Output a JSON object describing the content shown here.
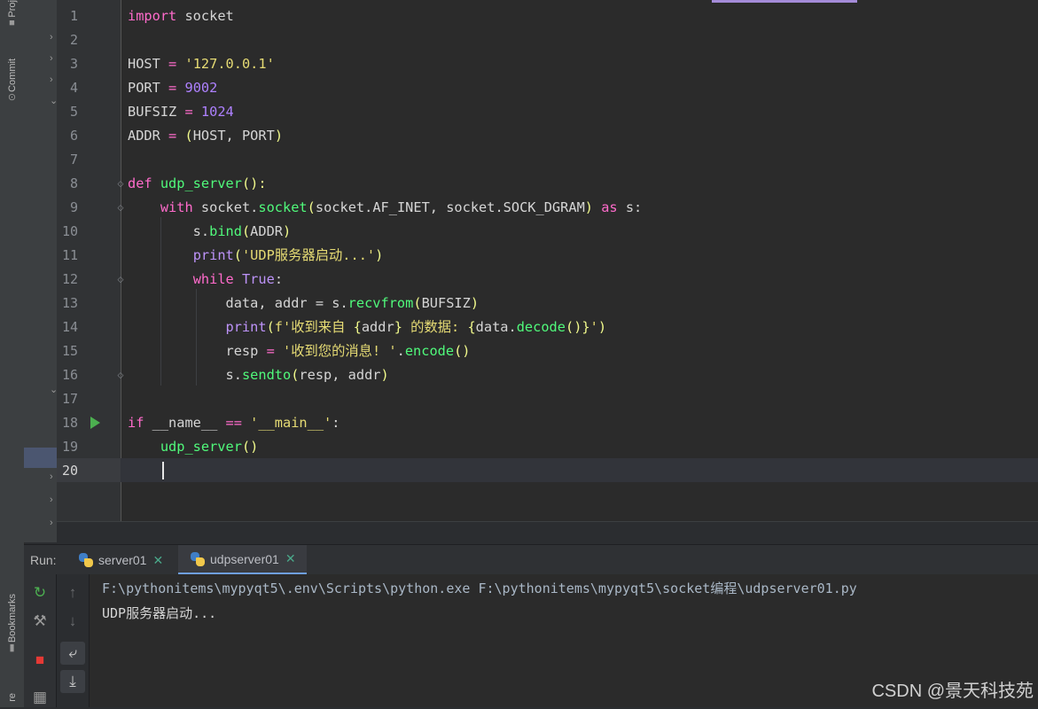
{
  "tool_window_stripe": {
    "project_label": "Proj",
    "commit_label": "Commit",
    "bookmarks_label": "Bookmarks",
    "structure_label": "re"
  },
  "editor": {
    "current_line": 20,
    "line_numbers": [
      "1",
      "2",
      "3",
      "4",
      "5",
      "6",
      "7",
      "8",
      "9",
      "10",
      "11",
      "12",
      "13",
      "14",
      "15",
      "16",
      "17",
      "18",
      "19",
      "20"
    ],
    "code_lines": [
      [
        {
          "t": "import",
          "c": "kw"
        },
        {
          "t": " socket",
          "c": "plain"
        }
      ],
      [],
      [
        {
          "t": "HOST",
          "c": "plain"
        },
        {
          "t": " = ",
          "c": "kw"
        },
        {
          "t": "'127.0.0.1'",
          "c": "str"
        }
      ],
      [
        {
          "t": "PORT",
          "c": "plain"
        },
        {
          "t": " = ",
          "c": "kw"
        },
        {
          "t": "9002",
          "c": "num"
        }
      ],
      [
        {
          "t": "BUFSIZ",
          "c": "plain"
        },
        {
          "t": " = ",
          "c": "kw"
        },
        {
          "t": "1024",
          "c": "num"
        }
      ],
      [
        {
          "t": "ADDR",
          "c": "plain"
        },
        {
          "t": " = ",
          "c": "kw"
        },
        {
          "t": "(",
          "c": "paren"
        },
        {
          "t": "HOST, PORT",
          "c": "plain"
        },
        {
          "t": ")",
          "c": "paren"
        }
      ],
      [],
      [
        {
          "t": "def ",
          "c": "kw"
        },
        {
          "t": "udp_server",
          "c": "fn"
        },
        {
          "t": "():",
          "c": "paren"
        }
      ],
      [
        {
          "t": "    ",
          "c": "plain"
        },
        {
          "t": "with",
          "c": "kw"
        },
        {
          "t": " socket.",
          "c": "plain"
        },
        {
          "t": "socket",
          "c": "fn"
        },
        {
          "t": "(",
          "c": "paren"
        },
        {
          "t": "socket.AF_INET, socket.SOCK_DGRAM",
          "c": "plain"
        },
        {
          "t": ")",
          "c": "paren"
        },
        {
          "t": " as",
          "c": "kw"
        },
        {
          "t": " s:",
          "c": "plain"
        }
      ],
      [
        {
          "t": "        s.",
          "c": "plain"
        },
        {
          "t": "bind",
          "c": "fn"
        },
        {
          "t": "(",
          "c": "paren"
        },
        {
          "t": "ADDR",
          "c": "plain"
        },
        {
          "t": ")",
          "c": "paren"
        }
      ],
      [
        {
          "t": "        ",
          "c": "plain"
        },
        {
          "t": "print",
          "c": "bi"
        },
        {
          "t": "(",
          "c": "paren"
        },
        {
          "t": "'UDP服务器启动...'",
          "c": "str"
        },
        {
          "t": ")",
          "c": "paren"
        }
      ],
      [
        {
          "t": "        ",
          "c": "plain"
        },
        {
          "t": "while",
          "c": "kw"
        },
        {
          "t": " True",
          "c": "bi"
        },
        {
          "t": ":",
          "c": "plain"
        }
      ],
      [
        {
          "t": "            data, addr = s.",
          "c": "plain"
        },
        {
          "t": "recvfrom",
          "c": "fn"
        },
        {
          "t": "(",
          "c": "paren"
        },
        {
          "t": "BUFSIZ",
          "c": "plain"
        },
        {
          "t": ")",
          "c": "paren"
        }
      ],
      [
        {
          "t": "            ",
          "c": "plain"
        },
        {
          "t": "print",
          "c": "bi"
        },
        {
          "t": "(",
          "c": "paren"
        },
        {
          "t": "f'收到来自 ",
          "c": "str"
        },
        {
          "t": "{",
          "c": "paren"
        },
        {
          "t": "addr",
          "c": "plain"
        },
        {
          "t": "}",
          "c": "paren"
        },
        {
          "t": " 的数据: ",
          "c": "str"
        },
        {
          "t": "{",
          "c": "paren"
        },
        {
          "t": "data.",
          "c": "plain"
        },
        {
          "t": "decode",
          "c": "fn"
        },
        {
          "t": "()",
          "c": "paren"
        },
        {
          "t": "}",
          "c": "paren"
        },
        {
          "t": "'",
          "c": "str"
        },
        {
          "t": ")",
          "c": "paren"
        }
      ],
      [
        {
          "t": "            resp ",
          "c": "plain"
        },
        {
          "t": "= ",
          "c": "kw"
        },
        {
          "t": "'收到您的消息! '",
          "c": "str"
        },
        {
          "t": ".",
          "c": "plain"
        },
        {
          "t": "encode",
          "c": "fn"
        },
        {
          "t": "()",
          "c": "paren"
        }
      ],
      [
        {
          "t": "            s.",
          "c": "plain"
        },
        {
          "t": "sendto",
          "c": "fn"
        },
        {
          "t": "(",
          "c": "paren"
        },
        {
          "t": "resp, addr",
          "c": "plain"
        },
        {
          "t": ")",
          "c": "paren"
        }
      ],
      [],
      [
        {
          "t": "if",
          "c": "kw"
        },
        {
          "t": " __name__ ",
          "c": "plain"
        },
        {
          "t": "==",
          "c": "kw"
        },
        {
          "t": " ",
          "c": "plain"
        },
        {
          "t": "'__main__'",
          "c": "str"
        },
        {
          "t": ":",
          "c": "plain"
        }
      ],
      [
        {
          "t": "    ",
          "c": "plain"
        },
        {
          "t": "udp_server",
          "c": "fn"
        },
        {
          "t": "()",
          "c": "paren"
        }
      ],
      []
    ]
  },
  "run_panel": {
    "title": "Run:",
    "tabs": [
      {
        "label": "server01",
        "active": false
      },
      {
        "label": "udpserver01",
        "active": true
      }
    ],
    "console": [
      {
        "text": "F:\\pythonitems\\mypyqt5\\.env\\Scripts\\python.exe F:\\pythonitems\\mypyqt5\\socket编程\\udpserver01.py",
        "kind": "cmd"
      },
      {
        "text": "UDP服务器启动...",
        "kind": "out"
      }
    ]
  },
  "watermark": "CSDN @景天科技苑",
  "colors": {
    "keyword": "#ff6bcb",
    "string": "#e6db74",
    "number": "#ae81ff",
    "function": "#50fa7b",
    "builtin": "#bd93f9",
    "paren": "#f1fa8c",
    "run_icon": "#4caf50",
    "stop_icon": "#e53935"
  }
}
